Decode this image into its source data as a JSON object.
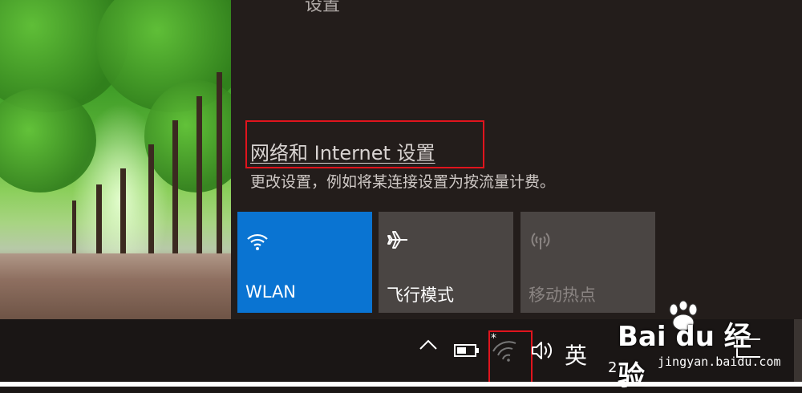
{
  "panel": {
    "top_partial_text": "设置",
    "network_settings_link": "网络和 Internet 设置",
    "network_settings_desc": "更改设置，例如将某连接设置为按流量计费。"
  },
  "tiles": [
    {
      "label": "WLAN",
      "icon": "wifi-icon",
      "state": "on"
    },
    {
      "label": "飞行模式",
      "icon": "airplane-icon",
      "state": "off"
    },
    {
      "label": "移动热点",
      "icon": "hotspot-icon",
      "state": "disabled"
    }
  ],
  "taskbar": {
    "show_hidden_icons": "^",
    "battery_icon": "battery-icon",
    "network_icon": "wifi-no-connection-icon",
    "network_badge": "*",
    "volume_icon": "volume-icon",
    "input_method": "英",
    "clock_partial": "2"
  },
  "watermark": {
    "brand": "Bai du 经验",
    "url": "jingyan.baidu.com"
  },
  "colors": {
    "accent": "#0a74d2",
    "highlight": "#e0141d",
    "panel_bg": "#231d1b",
    "tile_off": "#4a4543"
  }
}
